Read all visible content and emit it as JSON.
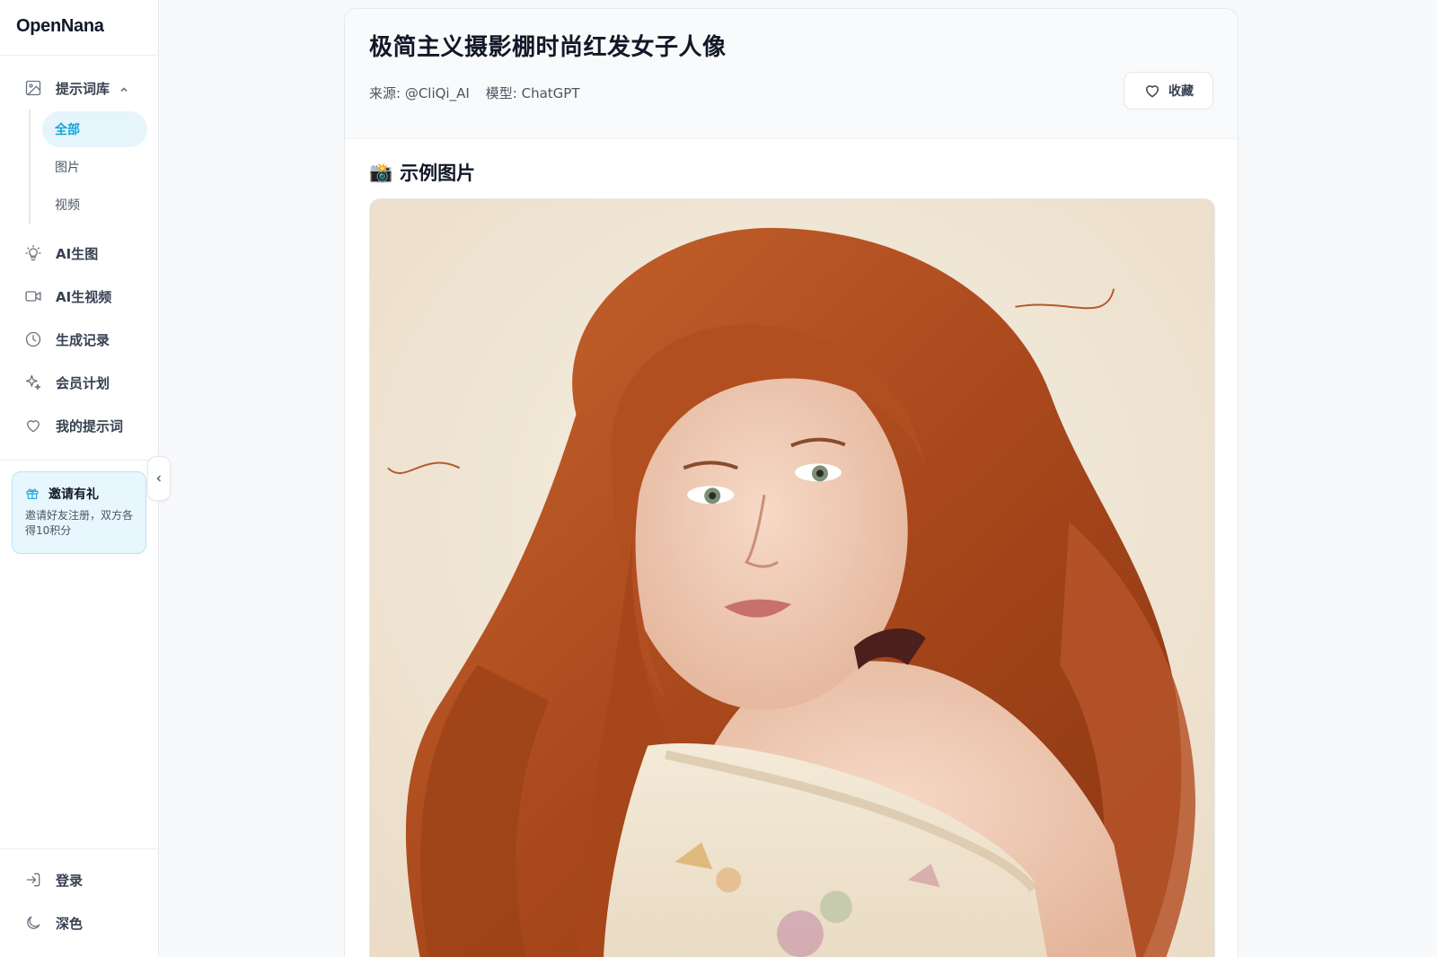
{
  "app": {
    "logo": "OpenNana"
  },
  "sidebar": {
    "prompt_library": {
      "label": "提示词库",
      "icon": "image-icon"
    },
    "sub_items": [
      {
        "label": "全部",
        "active": true
      },
      {
        "label": "图片",
        "active": false
      },
      {
        "label": "视频",
        "active": false
      }
    ],
    "items": [
      {
        "label": "AI生图",
        "icon": "lightbulb-icon"
      },
      {
        "label": "AI生视频",
        "icon": "video-icon"
      },
      {
        "label": "生成记录",
        "icon": "clock-icon"
      },
      {
        "label": "会员计划",
        "icon": "sparkle-icon"
      },
      {
        "label": "我的提示词",
        "icon": "heart-icon"
      }
    ],
    "invite": {
      "title": "邀请有礼",
      "desc": "邀请好友注册，双方各得10积分",
      "icon": "gift-icon"
    },
    "bottom": [
      {
        "label": "登录",
        "icon": "login-icon"
      },
      {
        "label": "深色",
        "icon": "moon-icon"
      }
    ]
  },
  "detail": {
    "title": "极简主义摄影棚时尚红发女子人像",
    "source": "来源: @CliQi_AI",
    "model": "模型: ChatGPT",
    "favorite_label": "收藏",
    "examples_heading": "示例图片",
    "examples_emoji": "📸"
  },
  "colors": {
    "accent": "#16a5d8",
    "accent_bg": "#e6f4fb",
    "invite_bg": "#e8f6fd"
  }
}
